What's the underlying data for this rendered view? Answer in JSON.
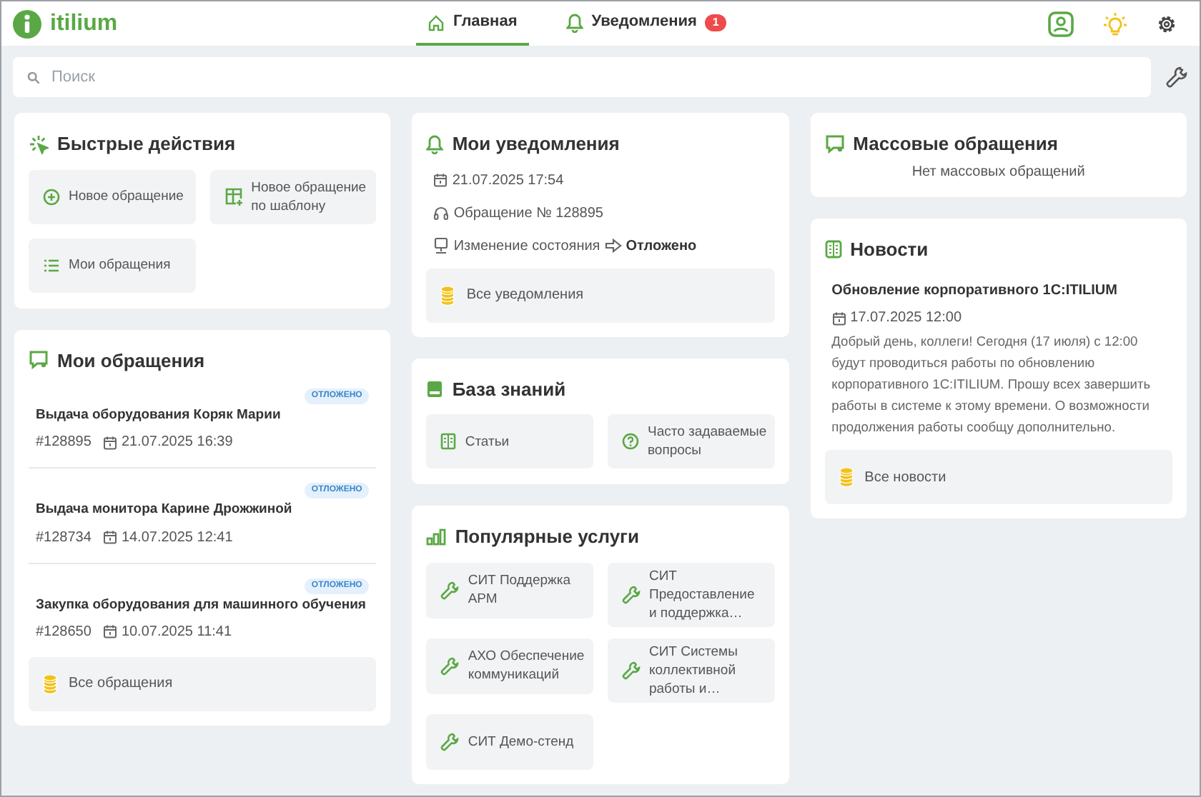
{
  "header": {
    "logo": "itilium",
    "tabs": [
      {
        "label": "Главная",
        "selected": true
      },
      {
        "label": "Уведомления",
        "selected": false,
        "badge": "1"
      }
    ]
  },
  "search": {
    "placeholder": "Поиск"
  },
  "quick_actions": {
    "title": "Быстрые действия",
    "items": [
      "Новое обращение",
      "Новое обращение по шаблону",
      "Мои обращения"
    ]
  },
  "my_requests": {
    "title": "Мои обращения",
    "items": [
      {
        "title": "Выдача оборудования Коряк Марии",
        "status": "ОТЛОЖЕНО",
        "number": "#128895",
        "date": "21.07.2025 16:39"
      },
      {
        "title": "Выдача монитора Карине Дрожжиной",
        "status": "ОТЛОЖЕНО",
        "number": "#128734",
        "date": "14.07.2025 12:41"
      },
      {
        "title": "Закупка оборудования для машинного обучения",
        "status": "ОТЛОЖЕНО",
        "number": "#128650",
        "date": "10.07.2025 11:41"
      }
    ],
    "all_link": "Все обращения"
  },
  "notifications": {
    "title": "Мои уведомления",
    "date": "21.07.2025 17:54",
    "request": "Обращение № 128895",
    "change": "Изменение состояния",
    "new_state": "Отложено",
    "all_link": "Все уведомления"
  },
  "knowledge_base": {
    "title": "База знаний",
    "items": [
      "Статьи",
      "Часто задаваемые вопросы"
    ]
  },
  "popular_services": {
    "title": "Популярные услуги",
    "items": [
      "СИТ Поддержка АРМ",
      "СИТ Предоставление и поддержка…",
      "АХО Обеспечение коммуникаций",
      "СИТ Системы коллективной работы и…",
      "СИТ Демо-стенд"
    ]
  },
  "mass_requests": {
    "title": "Массовые обращения",
    "empty_text": "Нет массовых обращений"
  },
  "news": {
    "title": "Новости",
    "items": [
      {
        "title": "Обновление корпоративного 1С:ITILIUM",
        "date": "17.07.2025 12:00",
        "text": "Добрый день, коллеги! Сегодня (17 июля) с 12:00 будут проводиться работы по обновлению корпоративного 1С:ITILIUM. Прошу всех завершить работы в системе к этому времени. О возможности продолжения работы сообщу дополнительно."
      }
    ],
    "all_link": "Все новости"
  }
}
